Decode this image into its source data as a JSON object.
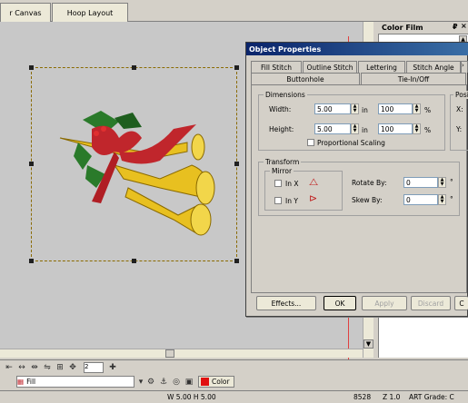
{
  "tabs": {
    "canvas": "r Canvas",
    "hoop": "Hoop Layout"
  },
  "color_film": {
    "title": "Color Film",
    "pin": "₽",
    "close": "×",
    "scroll_up": "▲"
  },
  "dialog": {
    "title": "Object Properties",
    "tabs_row1": [
      "Fill Stitch",
      "Outline Stitch",
      "Lettering",
      "Stitch Angle"
    ],
    "tabs_row2": [
      "Buttonhole",
      "Tie-In/Off"
    ],
    "dimensions": {
      "label": "Dimensions",
      "width_label": "Width:",
      "width_value": "5.00",
      "width_unit": "in",
      "width_pct": "100",
      "height_label": "Height:",
      "height_value": "5.00",
      "height_unit": "in",
      "height_pct": "100",
      "pct_symbol": "%",
      "proportional_label": "Proportional Scaling"
    },
    "position": {
      "label": "Posi",
      "x_label": "X:",
      "y_label": "Y:"
    },
    "transform": {
      "label": "Transform",
      "mirror_label": "Mirror",
      "in_x": "In X",
      "in_y": "In Y",
      "rotate_label": "Rotate By:",
      "rotate_value": "0",
      "skew_label": "Skew By:",
      "skew_value": "0",
      "degree": "°"
    },
    "buttons": {
      "effects": "Effects...",
      "ok": "OK",
      "apply": "Apply",
      "discard": "Discard",
      "cut": "C"
    }
  },
  "toolbar": {
    "fill_label": "Fill",
    "color_label": "Color",
    "zoom_value": "2"
  },
  "status": {
    "dims": "W 5.00 H 5.00",
    "stitch_count": "8528",
    "zoom": "Z 1.0",
    "art_grade": "ART Grade: C"
  },
  "colors": {
    "accent": "#0a246a",
    "thread_red": "#c0262c",
    "thread_gold": "#e8c020",
    "thread_green": "#2a7a2a"
  }
}
